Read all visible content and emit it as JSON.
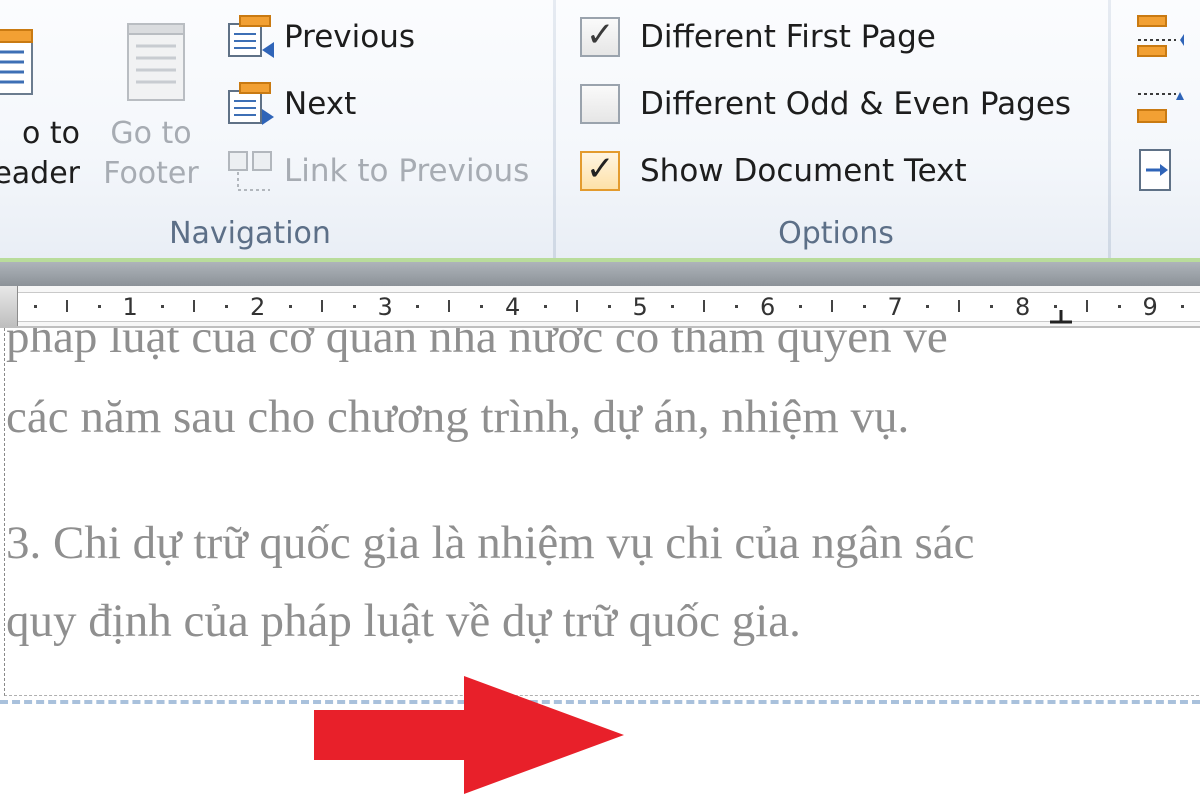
{
  "ribbon": {
    "navigation": {
      "go_to_header": [
        "o to",
        "eader"
      ],
      "go_to_footer": [
        "Go to",
        "Footer"
      ],
      "previous": "Previous",
      "next": "Next",
      "link_to_previous": "Link to Previous",
      "group_label": "Navigation"
    },
    "options": {
      "different_first_page": {
        "label": "Different First Page",
        "checked": true
      },
      "different_odd_even": {
        "label": "Different Odd & Even Pages",
        "checked": false
      },
      "show_document_text": {
        "label": "Show Document Text",
        "checked": true
      },
      "group_label": "Options"
    }
  },
  "ruler": {
    "numbers": [
      "1",
      "2",
      "3",
      "4",
      "5",
      "6",
      "7",
      "8",
      "9"
    ]
  },
  "document": {
    "lines": [
      "pháp luật của cơ quan nhà nước có thẩm quyền về",
      "các năm sau cho chương trình, dự án, nhiệm vụ.",
      "3. Chi dự trữ quốc gia là nhiệm vụ chi của ngân sác",
      "quy định của pháp luật về dự trữ quốc gia."
    ]
  },
  "colors": {
    "arrow": "#e8202a",
    "header_separator": "#a9c1dc",
    "ribbon_accent": "#b9dc9b",
    "doc_text": "#8f8f8f"
  },
  "icons": [
    "go-to-header-icon",
    "go-to-footer-icon",
    "previous-section-icon",
    "next-section-icon",
    "link-to-previous-icon",
    "checkbox-checked-icon",
    "red-arrow-right-icon"
  ]
}
